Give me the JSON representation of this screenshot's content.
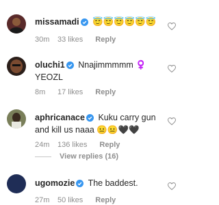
{
  "comments": [
    {
      "username": "missamadi",
      "verified": true,
      "text": "😇😇😇😇😇😇",
      "time": "30m",
      "likes": "33 likes",
      "reply": "Reply"
    },
    {
      "username": "oluchi1",
      "verified": true,
      "text": "Nnajimmmmm ♀️ YEOZL",
      "time": "8m",
      "likes": "17 likes",
      "reply": "Reply"
    },
    {
      "username": "aphricanace",
      "verified": true,
      "text": "Kuku carry gun and kill us naaa 😐😐🖤🖤",
      "time": "24m",
      "likes": "136 likes",
      "reply": "Reply"
    },
    {
      "username": "ugomozie",
      "verified": true,
      "text": "The baddest.",
      "time": "27m",
      "likes": "50 likes",
      "reply": "Reply"
    }
  ],
  "view_replies": "View replies (16)",
  "colors": {
    "verified": "#3897f0",
    "meta": "#8e8e8e",
    "avatar_missamadi": "#5a2a2a",
    "avatar_oluchi1": "#2b1f1a",
    "avatar_aphricanace": "#7a7f5a",
    "avatar_ugomozie": "#1f2d56"
  },
  "icons": [
    "heart-icon",
    "verified-badge-icon"
  ]
}
